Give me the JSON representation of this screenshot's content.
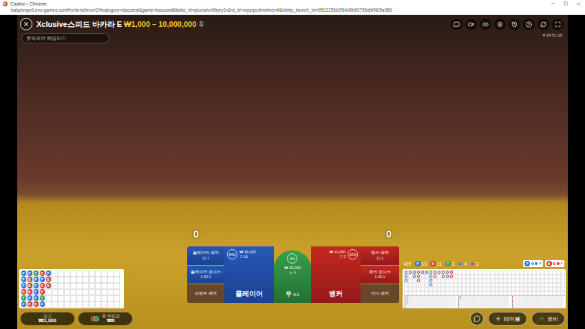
{
  "window": {
    "title": "Casino - Chrome",
    "url": "babylonpx9.evo-games.com/frontend/evo/r2/#category=baccarat&game=baccarat&table_id=qluosdvn5frpry1x&vt_id=srpyqecIimdmen4l&lobby_launch_id=0f511255b2f64d9b80755dbf060fa986"
  },
  "table": {
    "name": "Xclusive스피드 바카라 E",
    "limits": "₩1,000 – 10,000,000",
    "time": "# 19:51:20"
  },
  "chat": {
    "placeholder": "클릭하여 채팅하기"
  },
  "scores": {
    "player": "0",
    "banker": "0"
  },
  "sideBets": {
    "left": [
      {
        "kind": "player",
        "label": "플레이어 페어",
        "payout": "11:1"
      },
      {
        "kind": "player",
        "label": "플레이어 보너스",
        "payout": "1:30:1"
      },
      {
        "kind": "neutral",
        "label": "퍼펙트 페어"
      }
    ],
    "right": [
      {
        "kind": "banker",
        "label": "뱅커 페어",
        "payout": "11:1"
      },
      {
        "kind": "banker",
        "label": "뱅커 보너스",
        "payout": "1:30:1"
      },
      {
        "kind": "neutral",
        "label": "이더 페어"
      }
    ]
  },
  "mainBets": [
    {
      "kind": "player",
      "label": "플레이어",
      "percent": "54%",
      "amount": "₩ 16,400",
      "players": "10"
    },
    {
      "kind": "tie",
      "label": "무",
      "payout": "8:1",
      "percent": "4%",
      "amount": "₩ 25,000",
      "players": "4"
    },
    {
      "kind": "banker",
      "label": "뱅커",
      "percent": "42%",
      "amount": "₩ 11,000",
      "players": "2"
    }
  ],
  "beadRoad": [
    {
      "result": "P",
      "color": "#1e6fd9"
    },
    {
      "result": "P",
      "color": "#1e6fd9"
    },
    {
      "result": "P",
      "color": "#1e6fd9"
    },
    {
      "result": "B",
      "color": "#d9302b"
    },
    {
      "result": "T",
      "color": "#2e9e4f"
    },
    {
      "result": "P",
      "color": "#1e6fd9"
    },
    {
      "result": "P",
      "color": "#1e6fd9"
    },
    {
      "result": "B",
      "color": "#d9302b"
    },
    {
      "result": "B",
      "color": "#d9302b"
    },
    {
      "result": "B",
      "color": "#d9302b"
    },
    {
      "result": "P",
      "color": "#1e6fd9"
    },
    {
      "result": "B",
      "color": "#d9302b"
    },
    {
      "result": "T",
      "color": "#2e9e4f"
    },
    {
      "result": "P",
      "color": "#1e6fd9"
    },
    {
      "result": "P",
      "color": "#1e6fd9"
    },
    {
      "result": "P",
      "color": "#1e6fd9"
    },
    {
      "result": "P",
      "color": "#1e6fd9"
    },
    {
      "result": "B",
      "color": "#d9302b"
    },
    {
      "result": "B",
      "color": "#d9302b"
    },
    {
      "result": "P",
      "color": "#1e6fd9"
    },
    {
      "result": "B",
      "color": "#d9302b"
    },
    {
      "result": "B",
      "color": "#d9302b"
    },
    {
      "result": "T",
      "color": "#2e9e4f"
    },
    {
      "result": "P",
      "color": "#1e6fd9"
    },
    {
      "result": "P",
      "color": "#1e6fd9"
    },
    {
      "result": "B",
      "color": "#d9302b"
    },
    {
      "result": "B",
      "color": "#d9302b"
    }
  ],
  "stats": {
    "round": "#27",
    "counts": [
      {
        "label": "P",
        "value": "13",
        "color": "#1e6fd9"
      },
      {
        "label": "B",
        "value": "11",
        "color": "#d9302b"
      },
      {
        "label": "T",
        "value": "3",
        "color": "#2e9e4f"
      }
    ],
    "pairs": [
      {
        "value": "4",
        "color": "#1e6fd9"
      },
      {
        "value": "2",
        "color": "#d9302b"
      }
    ]
  },
  "predictions": [
    {
      "label": "P",
      "color": "#1e6fd9"
    },
    {
      "label": "B",
      "color": "#d9302b"
    }
  ],
  "bigRoad": [
    [
      "#1e6fd9",
      "#1e6fd9",
      "#1e6fd9"
    ],
    [
      "#d9302b"
    ],
    [
      "#1e6fd9",
      "#1e6fd9"
    ],
    [
      "#d9302b",
      "#d9302b",
      "#d9302b"
    ],
    [
      "#1e6fd9"
    ],
    [
      "#d9302b"
    ],
    [
      "#1e6fd9",
      "#1e6fd9",
      "#1e6fd9",
      "#1e6fd9"
    ],
    [
      "#d9302b",
      "#d9302b"
    ],
    [
      "#1e6fd9"
    ],
    [
      "#d9302b",
      "#d9302b"
    ],
    [
      "#1e6fd9",
      "#1e6fd9"
    ],
    [
      "#d9302b",
      "#d9302b"
    ]
  ],
  "derivedRoads": [
    [
      "#d9302b",
      "#d9302b",
      "#1e6fd9",
      "#d9302b",
      "#1e6fd9",
      "#1e6fd9",
      "#d9302b",
      "#d9302b",
      "#1e6fd9",
      "#d9302b"
    ],
    [
      "#1e6fd9",
      "#d9302b",
      "#d9302b",
      "#1e6fd9",
      "#d9302b",
      "#1e6fd9",
      "#1e6fd9",
      "#d9302b"
    ],
    [
      "#d9302b",
      "#1e6fd9",
      "#d9302b",
      "#d9302b",
      "#1e6fd9",
      "#d9302b"
    ]
  ],
  "wallet": {
    "balanceLabel": "잔고",
    "balance": "₩2,300",
    "totalBetLabel": "총 베팅금",
    "totalBet": "₩0"
  },
  "nav": {
    "tables": "테이블",
    "lobby": "로비"
  }
}
